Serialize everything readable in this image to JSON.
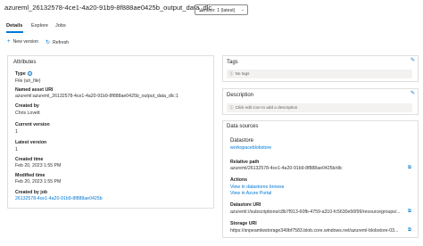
{
  "header": {
    "title": "azureml_26132578-4ce1-4a20-91b9-8f888ae0425b_output_data_dlc",
    "version_selected": "Version: 1 (latest)"
  },
  "tabs": [
    {
      "label": "Details",
      "active": true
    },
    {
      "label": "Explore",
      "active": false
    },
    {
      "label": "Jobs",
      "active": false
    }
  ],
  "toolbar": {
    "new_version": "New version",
    "refresh": "Refresh"
  },
  "attributes": {
    "title": "Attributes",
    "type_label": "Type",
    "type_value": "File (uri_file)",
    "named_asset_uri_label": "Named asset URI",
    "named_asset_uri_value": "azureml:azureml_26132578-4ce1-4a20-91b9-8f888ae0425b_output_data_dlc:1",
    "created_by_label": "Created by",
    "created_by_value": "Chris Lovett",
    "current_version_label": "Current version",
    "current_version_value": "1",
    "latest_version_label": "Latest version",
    "latest_version_value": "1",
    "created_time_label": "Created time",
    "created_time_value": "Feb 20, 2023 1:55 PM",
    "modified_time_label": "Modified time",
    "modified_time_value": "Feb 20, 2023 1:55 PM",
    "created_by_job_label": "Created by job",
    "created_by_job_value": "26132578-4ce1-4a20-91b9-8f888ae0425b"
  },
  "tags": {
    "title": "Tags",
    "empty_text": "No tags"
  },
  "description": {
    "title": "Description",
    "empty_text": "Click edit icon to add a description"
  },
  "datasources": {
    "title": "Data sources",
    "datastore_label": "Datastore",
    "datastore_value": "workspaceblobstore",
    "relative_path_label": "Relative path",
    "relative_path_value": "azureml/26132578-4ce1-4a20-91b9-8f888ae0425b/dlc",
    "actions_label": "Actions",
    "action_browse": "View in datastores browse",
    "action_portal": "View in Azure Portal",
    "datastore_uri_label": "Datastore URI",
    "datastore_uri_value": "azureml://subscriptions/c8b7f913-60fb-4759-a310-fc5630e56f99/resourcegroups/...",
    "storage_uri_label": "Storage URI",
    "storage_uri_value": "https://snpeamlwstorage349bf7583.blob.core.windows.net/azureml-blobstore-03..."
  },
  "colors": {
    "accent": "#0078d4",
    "border": "#e1dfdd",
    "notice_bg": "#f3f2f1"
  },
  "icons": [
    "info-icon",
    "plus-icon",
    "refresh-icon",
    "edit-icon",
    "copy-icon",
    "chevron-down-icon"
  ]
}
